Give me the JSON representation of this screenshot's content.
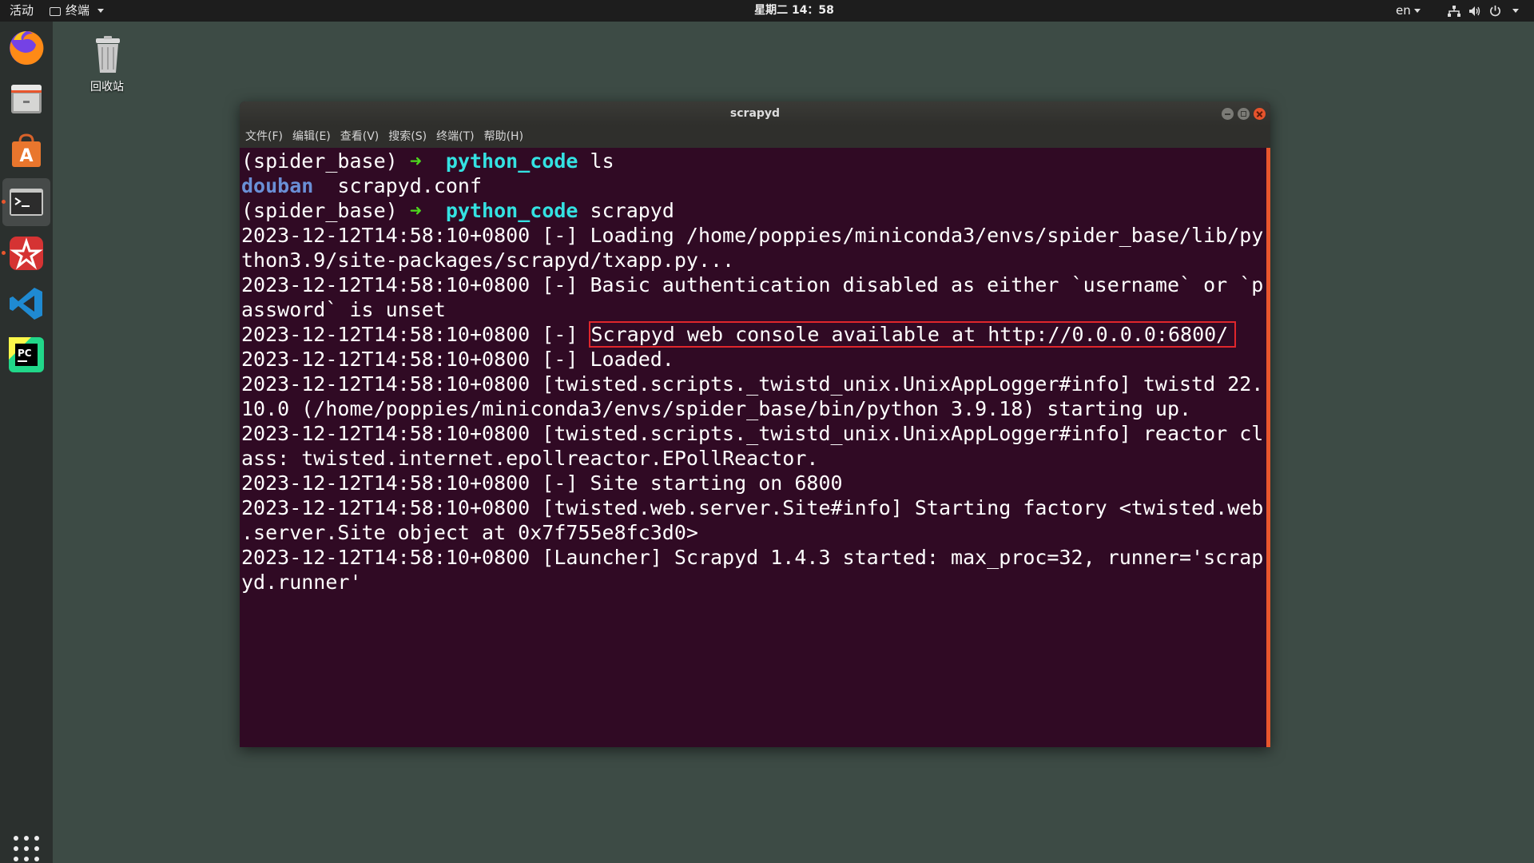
{
  "topbar": {
    "activities": "活动",
    "app_menu": "终端",
    "clock": "星期二 14：58",
    "lang": "en"
  },
  "dock": {
    "items": [
      {
        "name": "firefox-icon"
      },
      {
        "name": "file-manager-icon"
      },
      {
        "name": "software-center-icon"
      },
      {
        "name": "terminal-icon"
      },
      {
        "name": "app-icon"
      },
      {
        "name": "vscode-icon"
      },
      {
        "name": "pycharm-icon"
      }
    ]
  },
  "desktop": {
    "trash_label": "回收站"
  },
  "window": {
    "title": "scrapyd",
    "menu": [
      "文件(F)",
      "编辑(E)",
      "查看(V)",
      "搜索(S)",
      "终端(T)",
      "帮助(H)"
    ]
  },
  "terminal": {
    "prompt_env": "(spider_base)",
    "prompt_arrow": "➜",
    "prompt_dir": "python_code",
    "cmd1": "ls",
    "ls_dir": "douban",
    "ls_file": "scrapyd.conf",
    "cmd2": "scrapyd",
    "lines": [
      "2023-12-12T14:58:10+0800 [-] Loading /home/poppies/miniconda3/envs/spider_base/lib/py",
      "thon3.9/site-packages/scrapyd/txapp.py...",
      "2023-12-12T14:58:10+0800 [-] Basic authentication disabled as either `username` or `p",
      "assword` is unset"
    ],
    "console_prefix": "2023-12-12T14:58:10+0800 [-] ",
    "console_msg": "Scrapyd web console available at http://0.0.0.0:6800/",
    "lines2": [
      "2023-12-12T14:58:10+0800 [-] Loaded.",
      "2023-12-12T14:58:10+0800 [twisted.scripts._twistd_unix.UnixAppLogger#info] twistd 22.",
      "10.0 (/home/poppies/miniconda3/envs/spider_base/bin/python 3.9.18) starting up.",
      "2023-12-12T14:58:10+0800 [twisted.scripts._twistd_unix.UnixAppLogger#info] reactor cl",
      "ass: twisted.internet.epollreactor.EPollReactor.",
      "2023-12-12T14:58:10+0800 [-] Site starting on 6800",
      "2023-12-12T14:58:10+0800 [twisted.web.server.Site#info] Starting factory <twisted.web",
      ".server.Site object at 0x7f755e8fc3d0>",
      "2023-12-12T14:58:10+0800 [Launcher] Scrapyd 1.4.3 started: max_proc=32, runner='scrap",
      "yd.runner'"
    ]
  }
}
